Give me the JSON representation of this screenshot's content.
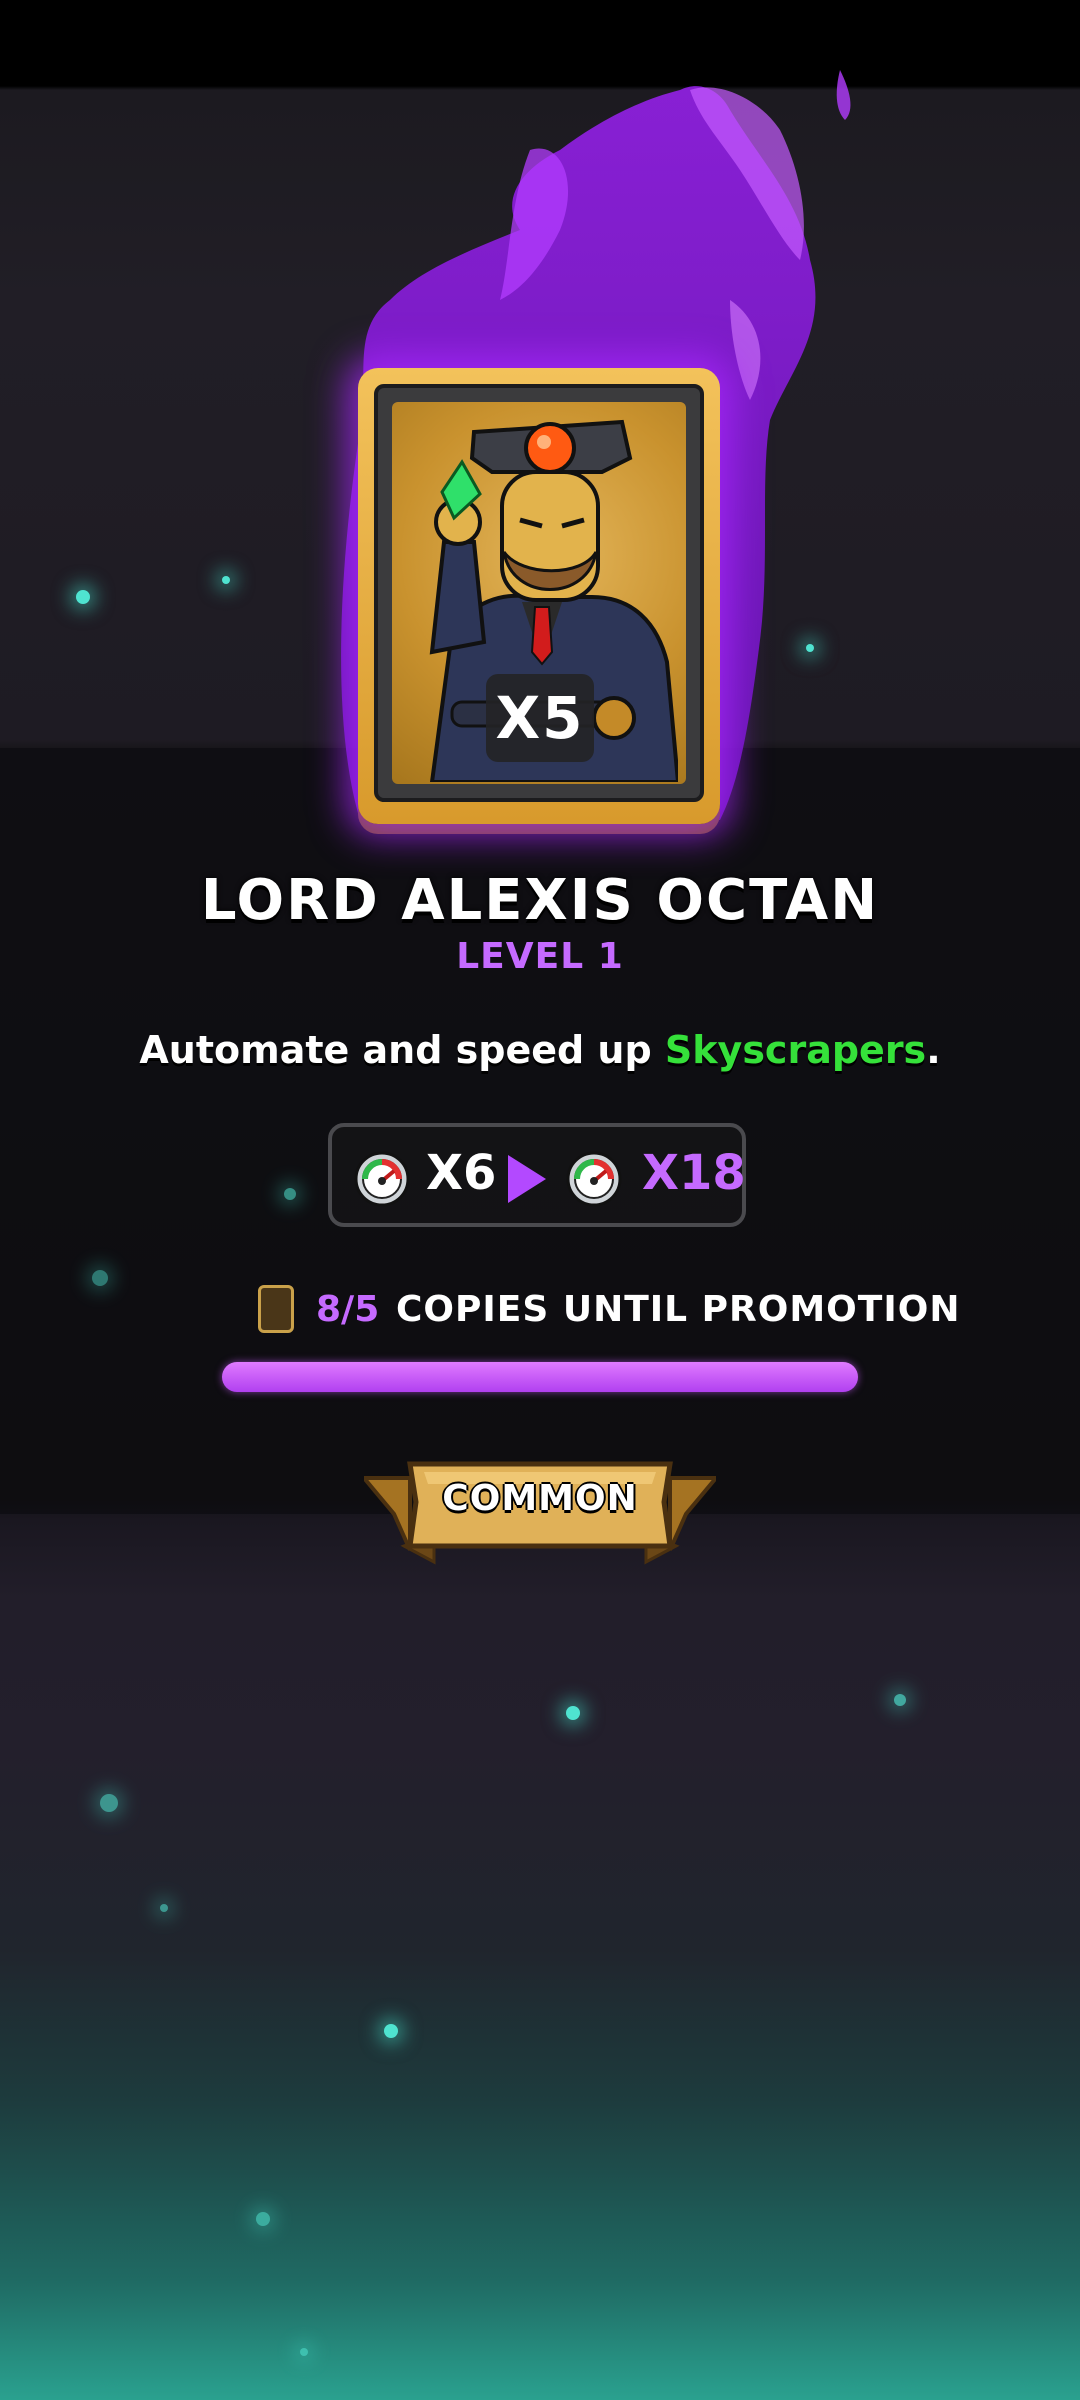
{
  "hero": {
    "name": "LORD ALEXIS OCTAN",
    "level": "LEVEL 1",
    "card_count": "X5"
  },
  "description": {
    "prefix": "Automate and speed up ",
    "highlight": "Skyscrapers",
    "suffix": "."
  },
  "boost": {
    "current": "X6",
    "next": "X18",
    "icon": "speedometer-icon"
  },
  "promotion": {
    "count": "8/5",
    "label": "COPIES UNTIL PROMOTION",
    "progress_fraction": 1.0
  },
  "rarity": {
    "label": "COMMON"
  },
  "colors": {
    "accent_purple": "#c56aff",
    "highlight_green": "#35e13a",
    "card_gold": "#e8b24a"
  }
}
